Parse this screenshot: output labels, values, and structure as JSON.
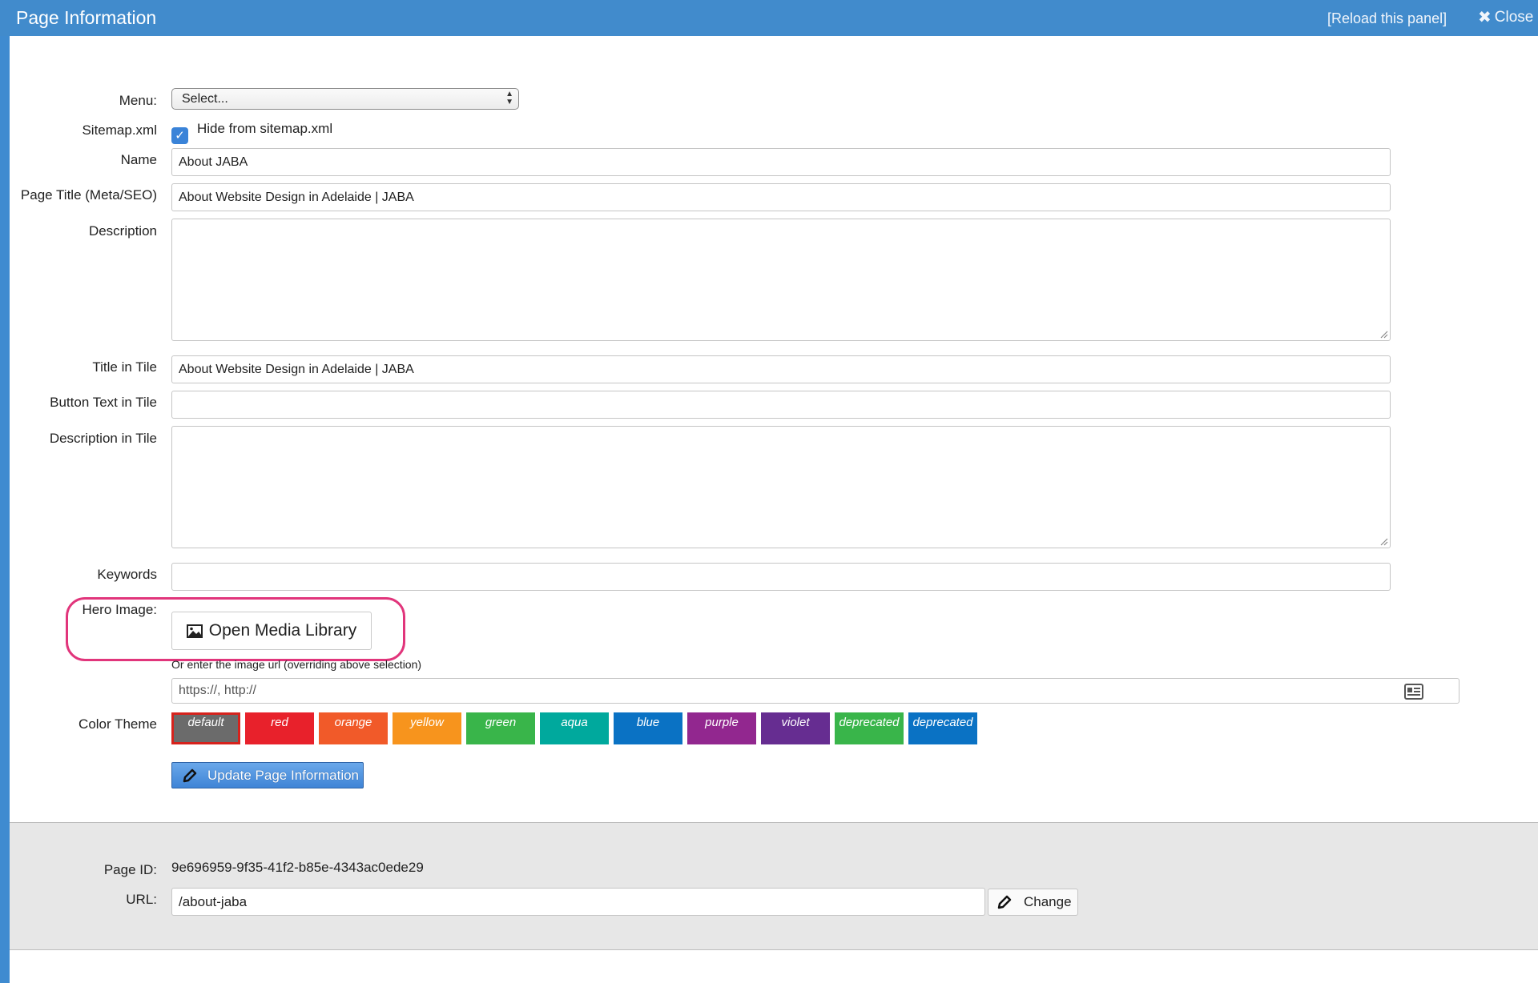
{
  "header": {
    "title": "Page Information",
    "reload_label": "[Reload this panel]",
    "close_label": "Close"
  },
  "form": {
    "menu": {
      "label": "Menu:",
      "selected": "Select..."
    },
    "sitemap": {
      "label": "Sitemap.xml",
      "checkbox_label": "Hide from sitemap.xml",
      "checked": true
    },
    "name": {
      "label": "Name",
      "value": "About JABA"
    },
    "page_title": {
      "label": "Page Title (Meta/SEO)",
      "value": "About Website Design in Adelaide | JABA"
    },
    "description": {
      "label": "Description",
      "value": ""
    },
    "title_in_tile": {
      "label": "Title in Tile",
      "value": "About Website Design in Adelaide | JABA"
    },
    "button_text_in_tile": {
      "label": "Button Text in Tile",
      "value": ""
    },
    "description_in_tile": {
      "label": "Description in Tile",
      "value": ""
    },
    "keywords": {
      "label": "Keywords",
      "value": ""
    },
    "hero_image": {
      "label": "Hero Image:",
      "button_label": "Open Media Library",
      "hint": "Or enter the image url (overriding above selection)",
      "url_placeholder": "https://, http://"
    },
    "color_theme": {
      "label": "Color Theme",
      "selected": "default",
      "options": [
        {
          "name": "default",
          "color": "#6b6b6b"
        },
        {
          "name": "red",
          "color": "#e8212b"
        },
        {
          "name": "orange",
          "color": "#f15a29"
        },
        {
          "name": "yellow",
          "color": "#f7941d"
        },
        {
          "name": "green",
          "color": "#39b54a"
        },
        {
          "name": "aqua",
          "color": "#00a99d"
        },
        {
          "name": "blue",
          "color": "#0a72c4"
        },
        {
          "name": "purple",
          "color": "#92278f"
        },
        {
          "name": "violet",
          "color": "#662d91"
        },
        {
          "name": "deprecated",
          "color": "#39b54a"
        },
        {
          "name": "deprecated",
          "color": "#0a72c4"
        }
      ]
    },
    "update_button_label": "Update Page Information"
  },
  "footer": {
    "page_id_label": "Page ID:",
    "page_id_value": "9e696959-9f35-41f2-b85e-4343ac0ede29",
    "url_label": "URL:",
    "url_value": "/about-jaba",
    "change_label": "Change"
  }
}
